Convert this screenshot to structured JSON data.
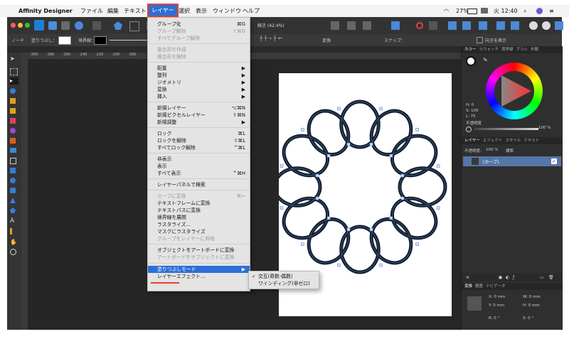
{
  "menubar": {
    "app_name": "Affinity Designer",
    "items": [
      "ファイル",
      "編集",
      "テキスト",
      "レイヤー",
      "選択",
      "表示",
      "ウィンドウ",
      "ヘルプ"
    ],
    "battery": "27%",
    "clock": "火 12:40"
  },
  "toolbar": {
    "zoom_text": "続き (42.4%)",
    "snap_label": "スナップ：",
    "transform_label": "変換",
    "show_label": "向きを表示"
  },
  "context_bar": {
    "node_label": "ノード",
    "fill_label": "塗りつぶし：",
    "stroke_label": "境界線："
  },
  "ruler": {
    "h_ticks": [
      "-300",
      "-280",
      "-260",
      "-240",
      "-220",
      "-200",
      "-180"
    ],
    "v_ticks": [
      "1",
      "2",
      "3",
      "4",
      "5",
      "6",
      "7",
      "8",
      "9",
      "10",
      "11",
      "12",
      "13"
    ]
  },
  "menu": {
    "items": [
      {
        "label": "グループ化",
        "shortcut": "⌘G",
        "disabled": false
      },
      {
        "label": "グループ解除",
        "shortcut": "⇧⌘G",
        "disabled": true
      },
      {
        "label": "すべてグループ解除",
        "shortcut": "",
        "disabled": true
      },
      {
        "label": "複合形を作成",
        "shortcut": "",
        "disabled": true
      },
      {
        "label": "複合形を解除",
        "shortcut": "",
        "disabled": true
      },
      {
        "label": "配置",
        "shortcut": "▶",
        "disabled": false
      },
      {
        "label": "整列",
        "shortcut": "▶",
        "disabled": false
      },
      {
        "label": "ジオメトリ",
        "shortcut": "▶",
        "disabled": false
      },
      {
        "label": "変換",
        "shortcut": "▶",
        "disabled": false
      },
      {
        "label": "挿入",
        "shortcut": "▶",
        "disabled": false
      },
      {
        "label": "新規レイヤー",
        "shortcut": "⌥⌘N",
        "disabled": false
      },
      {
        "label": "新規ピクセルレイヤー",
        "shortcut": "⇧⌘N",
        "disabled": false
      },
      {
        "label": "新規調整",
        "shortcut": "▶",
        "disabled": false
      },
      {
        "label": "ロック",
        "shortcut": "⌘L",
        "disabled": false
      },
      {
        "label": "ロックを解除",
        "shortcut": "⇧⌘L",
        "disabled": false
      },
      {
        "label": "すべてロック解除",
        "shortcut": "^⌘L",
        "disabled": false
      },
      {
        "label": "非表示",
        "shortcut": "",
        "disabled": false
      },
      {
        "label": "表示",
        "shortcut": "",
        "disabled": false
      },
      {
        "label": "すべて表示",
        "shortcut": "^⌘H",
        "disabled": false
      },
      {
        "label": "レイヤーパネルで検索",
        "shortcut": "",
        "disabled": false
      },
      {
        "label": "カーブに変換",
        "shortcut": "⌘↩",
        "disabled": true
      },
      {
        "label": "テキストフレームに変換",
        "shortcut": "",
        "disabled": false
      },
      {
        "label": "テキストパスに変換",
        "shortcut": "",
        "disabled": false
      },
      {
        "label": "境界線を展開",
        "shortcut": "",
        "disabled": false
      },
      {
        "label": "ラスタライズ...",
        "shortcut": "",
        "disabled": false
      },
      {
        "label": "マスクにラスタライズ",
        "shortcut": "",
        "disabled": false
      },
      {
        "label": "グループをレイヤーに昇格",
        "shortcut": "",
        "disabled": true
      },
      {
        "label": "オブジェクトをアートボードに変換",
        "shortcut": "",
        "disabled": false
      },
      {
        "label": "アートボードをオブジェクトに変換",
        "shortcut": "",
        "disabled": true
      },
      {
        "label": "塗りつぶしモード",
        "shortcut": "▶",
        "disabled": false,
        "highlighted": true
      },
      {
        "label": "レイヤーエフェクト...",
        "shortcut": "",
        "disabled": false
      }
    ]
  },
  "submenu": {
    "items": [
      {
        "check": "✓",
        "label": "交互(奇数-偶数)"
      },
      {
        "check": "",
        "label": "ワインディング(非ゼロ)"
      }
    ]
  },
  "color_panel": {
    "tabs": [
      "カラー",
      "スウォッチ",
      "境界線",
      "ブラシ",
      "外観"
    ],
    "h": "H: 0",
    "s": "S: 100",
    "l": "L: 75",
    "opacity_label": "不透明度",
    "opacity_value": "100 %"
  },
  "layers_panel": {
    "tabs": [
      "レイヤー",
      "エフェクト",
      "スタイル",
      "テキスト"
    ],
    "opacity_label": "不透明度:",
    "opacity_value": "100 %",
    "blend": "標準",
    "layer_name": "(カーブ)"
  },
  "transform_panel": {
    "tabs": [
      "変換",
      "履歴",
      "ナビゲータ"
    ],
    "x": "X: 0 mm",
    "y": "Y: 0 mm",
    "w": "W: 0 mm",
    "h": "H: 0 mm",
    "r": "R: 0 °",
    "s": "S: 0 °"
  },
  "colors": {
    "accent": "#2d6fd6",
    "highlight_box": "#e8412c",
    "artwork_stroke": "#111c2c"
  }
}
